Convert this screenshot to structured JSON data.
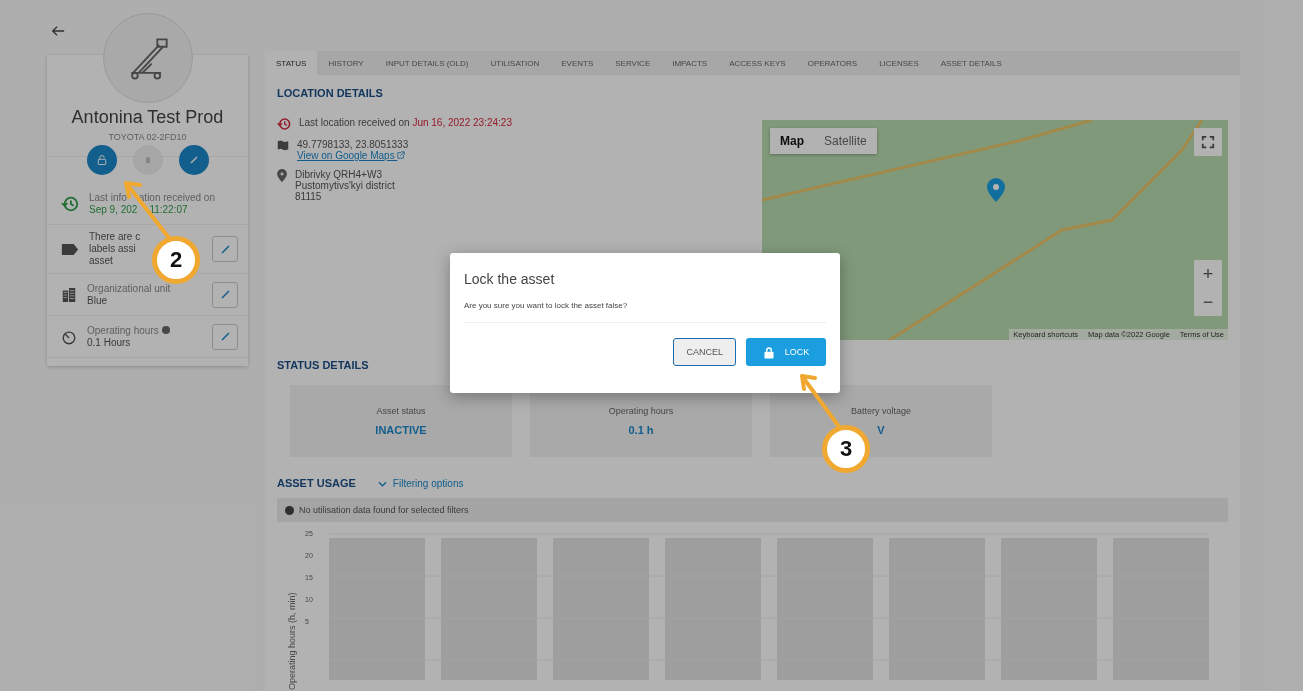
{
  "asset": {
    "name": "Antonina Test Prod",
    "model": "TOYOTA 02-2FD10",
    "locked": false,
    "last_info": {
      "label_parts": [
        "Last info",
        "ation received on"
      ],
      "date_parts": [
        "Sep 9, 202",
        "11:22:07"
      ]
    },
    "details": [
      {
        "kind": "labels",
        "lines": [
          "There are c",
          "labels assi",
          "asset"
        ]
      },
      {
        "kind": "org",
        "title": "Organizational unit",
        "value": "Blue"
      },
      {
        "kind": "hours",
        "title": "Operating hours",
        "value": "0.1 Hours"
      }
    ]
  },
  "tabs": [
    {
      "label": "STATUS",
      "selected": true
    },
    {
      "label": "HISTORY",
      "selected": false
    },
    {
      "label": "INPUT DETAILS (OLD)",
      "selected": false
    },
    {
      "label": "UTILISATION",
      "selected": false
    },
    {
      "label": "EVENTS",
      "selected": false
    },
    {
      "label": "SERVICE",
      "selected": false
    },
    {
      "label": "IMPACTS",
      "selected": false
    },
    {
      "label": "ACCESS KEYS",
      "selected": false
    },
    {
      "label": "OPERATORS",
      "selected": false
    },
    {
      "label": "LICENSES",
      "selected": false
    },
    {
      "label": "ASSET DETAILS",
      "selected": false
    }
  ],
  "location": {
    "heading": "LOCATION DETAILS",
    "last_label": "Last location received on",
    "last_date": "Jun 16, 2022 23:24:23",
    "coords": "49.7798133, 23.8051333",
    "maps_link": "View on Google Maps",
    "address": [
      "Dibrivky QRH4+W3",
      "Pustomytivs'kyi district",
      "81115"
    ]
  },
  "map": {
    "types": [
      {
        "label": "Map",
        "selected": true
      },
      {
        "label": "Satellite",
        "selected": false
      }
    ],
    "zoom_in": "+",
    "zoom_out": "−",
    "footer": [
      "Keyboard shortcuts",
      "Map data ©2022 Google",
      "Terms of Use"
    ]
  },
  "status": {
    "heading": "STATUS DETAILS",
    "cards": [
      {
        "label": "Asset status",
        "value": "INACTIVE"
      },
      {
        "label": "Operating hours",
        "value": "0.1 h"
      },
      {
        "label": "Battery voltage",
        "value": "V"
      }
    ]
  },
  "usage": {
    "heading": "ASSET USAGE",
    "filter": "Filtering options",
    "notice": "No utilisation data found for selected filters",
    "ylabel": "Operating hours (h, min)",
    "yticks": [
      "25",
      "20",
      "15",
      "10",
      "5"
    ]
  },
  "dialog": {
    "title": "Lock the asset",
    "message": "Are you sure you want to lock the asset false?",
    "cancel": "CANCEL",
    "confirm": "LOCK"
  },
  "callouts": [
    "2",
    "3"
  ]
}
